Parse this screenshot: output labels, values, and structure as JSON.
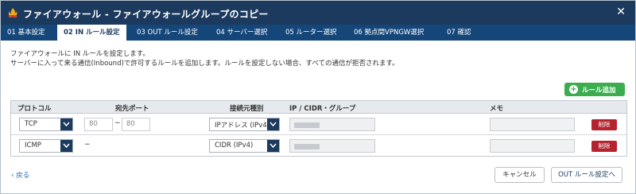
{
  "window": {
    "title": "ファイアウォール - ファイアウォールグループのコピー",
    "close_label": "✕"
  },
  "tabs": [
    {
      "label": "01 基本設定",
      "active": false
    },
    {
      "label": "02 IN ルール設定",
      "active": true
    },
    {
      "label": "03 OUT ルール設定",
      "active": false
    },
    {
      "label": "04 サーバー選択",
      "active": false
    },
    {
      "label": "05 ルーター選択",
      "active": false
    },
    {
      "label": "06 拠点間VPNGW選択",
      "active": false
    },
    {
      "label": "07 確認",
      "active": false
    }
  ],
  "description": {
    "line1": "ファイアウォールに IN ルールを設定します。",
    "line2": "サーバーに入って来る通信(Inbound)で許可するルールを追加します。ルールを設定しない場合、すべての通信が拒否されます。"
  },
  "add_rule_label": "ルール追加",
  "table": {
    "headers": {
      "protocol": "プロトコル",
      "dest_port": "宛先ポート",
      "source_type": "接続元種別",
      "ip_cidr_group": "IP / CIDR・グループ",
      "memo": "メモ"
    },
    "rows": [
      {
        "protocol": "TCP",
        "port_from": "80",
        "port_separator": "−",
        "port_to": "80",
        "source_type": "IPアドレス (IPv4)",
        "ip": "",
        "memo": "",
        "delete_label": "削除"
      },
      {
        "protocol": "ICMP",
        "port_separator": "−",
        "source_type": "CIDR (IPv4)",
        "ip": "",
        "memo": "",
        "delete_label": "削除"
      }
    ]
  },
  "footer": {
    "back_label": "戻る",
    "cancel_label": "キャンセル",
    "next_label": "OUT ルール設定へ"
  },
  "colors": {
    "titlebar": "#1c3a5e",
    "tabbar": "#15467a",
    "add_button": "#3cad4f",
    "delete_button": "#b5232e",
    "link": "#1e6bb8"
  },
  "icons": {
    "title": "firewall-icon",
    "close": "close-icon",
    "add": "plus-circle-icon",
    "dropdown": "chevron-down-icon",
    "back": "chevron-left-icon"
  }
}
